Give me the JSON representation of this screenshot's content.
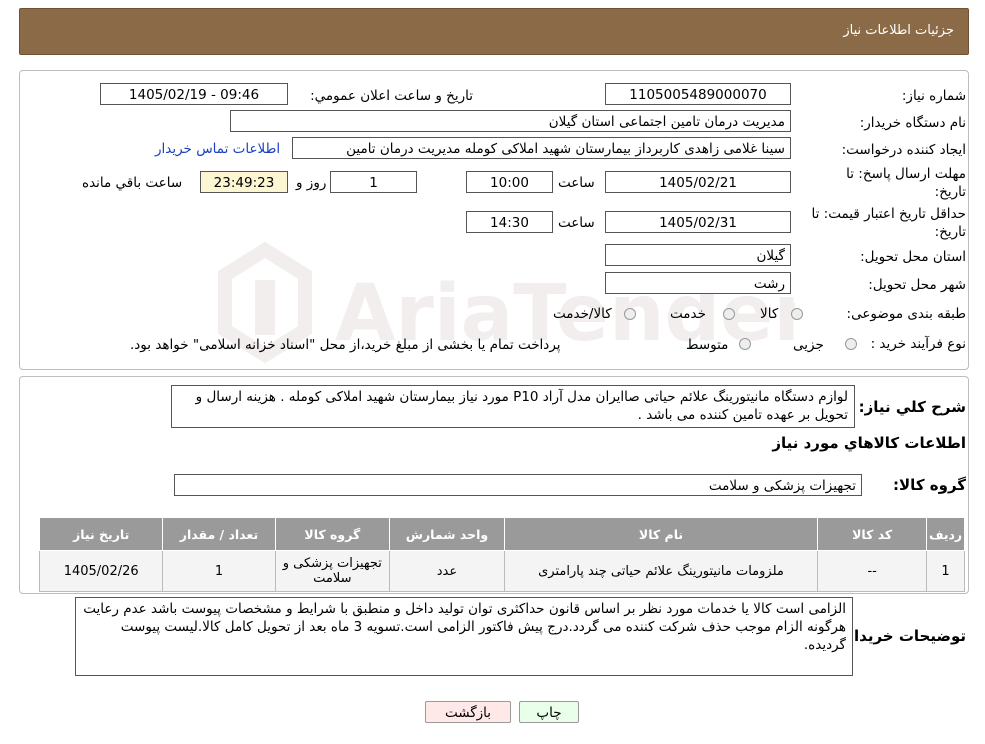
{
  "header": {
    "title": "جزئیات اطلاعات نیاز"
  },
  "fields": {
    "need_number_label": "شماره نياز:",
    "need_number": "1105005489000070",
    "announce_label": "تاريخ و ساعت اعلان عمومي:",
    "announce_value": "1405/02/19 - 09:46",
    "buyer_org_label": "نام دستگاه خريدار:",
    "buyer_org": "مدیریت درمان تامین اجتماعی استان گیلان",
    "creator_label": "ايجاد کننده درخواست:",
    "creator": "سینا غلامی زاهدی کاربرداز بیمارستان شهید املاکی کومله مدیریت درمان تامین",
    "contact_link": "اطلاعات تماس خريدار",
    "reply_deadline_label": "مهلت ارسال پاسخ: تا",
    "reply_deadline_label2": "تاريخ:",
    "reply_date": "1405/02/21",
    "time_label": "ساعت",
    "reply_time": "10:00",
    "days_value": "1",
    "days_label": "روز و",
    "remaining_time": "23:49:23",
    "remaining_label": "ساعت باقي مانده",
    "validity_label": "حداقل تاريخ اعتبار قيمت: تا",
    "validity_label2": "تاريخ:",
    "validity_date": "1405/02/31",
    "validity_time": "14:30",
    "province_label": "استان محل تحويل:",
    "province": "گیلان",
    "city_label": "شهر محل تحويل:",
    "city": "رشت",
    "category_label": "طبقه بندی موضوعی:",
    "category_options": [
      "کالا",
      "خدمت",
      "کالا/خدمت"
    ],
    "purchase_type_label": "نوع فرآیند خرید :",
    "purchase_options": [
      "جزیی",
      "متوسط"
    ],
    "purchase_note": "پرداخت تمام یا بخشی از مبلغ خرید،از محل \"اسناد خزانه اسلامی\" خواهد بود."
  },
  "description": {
    "label": "شرح کلي نياز:",
    "text": "لوازم دستگاه مانیتورینگ علائم حیاتی صاایران مدل آراد P10 مورد نیاز بیمارستان شهید املاکی کومله . هزینه ارسال و تحویل بر عهده تامین کننده می باشد ."
  },
  "goods": {
    "section_title": "اطلاعات کالاهاي مورد نياز",
    "group_label": "گروه کالا:",
    "group_value": "تجهیزات پزشکی و سلامت",
    "columns": [
      "رديف",
      "کد کالا",
      "نام کالا",
      "واحد شمارش",
      "گروه کالا",
      "تعداد / مقدار",
      "تاريخ نياز"
    ],
    "rows": [
      [
        "1",
        "--",
        "ملزومات مانیتورینگ علائم حیاتی چند پارامتری",
        "عدد",
        "تجهیزات پزشکی و سلامت",
        "1",
        "1405/02/26"
      ]
    ]
  },
  "buyer_notes": {
    "label": "توضيحات خريدار:",
    "text": "الزامی است کالا یا خدمات مورد نظر بر اساس قانون حداکثری توان تولید داخل و منطبق با شرایط و مشخصات پیوست باشد عدم رعایت هرگونه الزام موجب حذف شرکت کننده می گردد.درج پیش فاکتور الزامی است.تسویه 3 ماه بعد از تحویل کامل کالا.لیست پیوست گردیده."
  },
  "buttons": {
    "print": "چاپ",
    "back": "بازگشت"
  },
  "colors": {
    "header_bg": "#8b6b47",
    "print_bg": "#eaffea",
    "back_bg": "#ffe8e8",
    "link": "#1a3fc4"
  }
}
